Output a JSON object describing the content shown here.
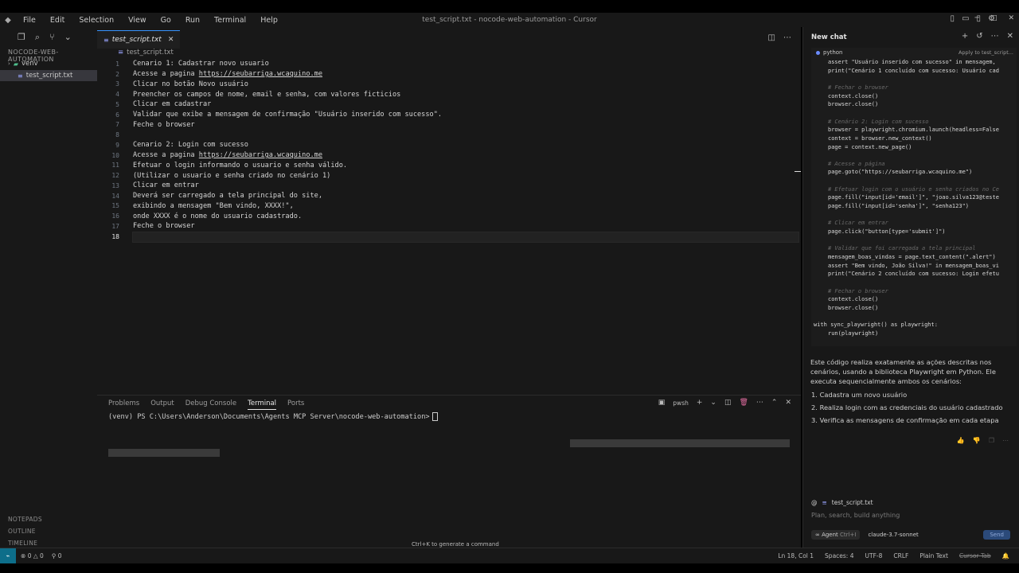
{
  "window": {
    "title": "test_script.txt - nocode-web-automation - Cursor",
    "menu": [
      "File",
      "Edit",
      "Selection",
      "View",
      "Go",
      "Run",
      "Terminal",
      "Help"
    ]
  },
  "sidebar": {
    "title": "NOCODE-WEB-AUTOMATION",
    "items": [
      {
        "label": "venv",
        "type": "folder"
      },
      {
        "label": "test_script.txt",
        "type": "file"
      }
    ],
    "footer": [
      "NOTEPADS",
      "OUTLINE",
      "TIMELINE"
    ]
  },
  "editor": {
    "tab": "test_script.txt",
    "breadcrumb": "test_script.txt",
    "lines": [
      {
        "n": "1",
        "text": "Cenario 1: Cadastrar novo usuario"
      },
      {
        "n": "2",
        "pre": "Acesse a pagina ",
        "link": "https://seubarriga.wcaquino.me"
      },
      {
        "n": "3",
        "text": "Clicar no botão Novo usuário"
      },
      {
        "n": "4",
        "text": "Preencher os campos de nome, email e senha, com valores ficticios"
      },
      {
        "n": "5",
        "text": "Clicar em cadastrar"
      },
      {
        "n": "6",
        "text": "Validar que exibe a mensagem de confirmação \"Usuário inserido com sucesso\"."
      },
      {
        "n": "7",
        "text": "Feche o browser"
      },
      {
        "n": "8",
        "text": ""
      },
      {
        "n": "9",
        "text": "Cenario 2: Login com sucesso"
      },
      {
        "n": "10",
        "pre": "Acesse a pagina ",
        "link": "https://seubarriga.wcaquino.me"
      },
      {
        "n": "11",
        "text": "Efetuar o login informando o usuario e senha válido."
      },
      {
        "n": "12",
        "text": "(Utilizar o usuario e senha criado no cenário 1)"
      },
      {
        "n": "13",
        "text": "Clicar em entrar"
      },
      {
        "n": "14",
        "text": "Deverá ser carregado a tela principal do site,"
      },
      {
        "n": "15",
        "text": "exibindo a mensagem \"Bem vindo, XXXX!\","
      },
      {
        "n": "16",
        "text": "onde XXXX é o nome do usuario cadastrado."
      },
      {
        "n": "17",
        "text": "Feche o browser"
      },
      {
        "n": "18",
        "text": ""
      }
    ]
  },
  "panel": {
    "tabs": [
      "Problems",
      "Output",
      "Debug Console",
      "Terminal",
      "Ports"
    ],
    "active_tab": "Terminal",
    "shell": "pwsh",
    "prompt": "(venv) PS C:\\Users\\Anderson\\Documents\\Agents MCP Server\\nocode-web-automation>",
    "hint": "Ctrl+K to generate a command"
  },
  "chat": {
    "title": "New chat",
    "code_lang": "python",
    "apply_label": "Apply to test_script...",
    "code_lines": [
      "assert \"Usuário inserido com sucesso\" in mensagem,",
      "print(\"Cenário 1 concluído com sucesso: Usuário cad",
      "",
      "# Fechar o browser",
      "context.close()",
      "browser.close()",
      "",
      "# Cenário 2: Login com sucesso",
      "browser = playwright.chromium.launch(headless=False",
      "context = browser.new_context()",
      "page = context.new_page()",
      "",
      "# Acesse a página",
      "page.goto(\"https://seubarriga.wcaquino.me\")",
      "",
      "# Efetuar login com o usuário e senha criados no Ce",
      "page.fill(\"input[id='email']\", \"joao.silva123@teste",
      "page.fill(\"input[id='senha']\", \"senha123\")",
      "",
      "# Clicar em entrar",
      "page.click(\"button[type='submit']\")",
      "",
      "# Validar que foi carregada a tela principal",
      "mensagem_boas_vindas = page.text_content(\".alert\")",
      "assert \"Bem vindo, João Silva!\" in mensagem_boas_vi",
      "print(\"Cenário 2 concluído com sucesso: Login efetu",
      "",
      "# Fechar o browser",
      "context.close()",
      "browser.close()",
      "",
      "with sync_playwright() as playwright:",
      "    run(playwright)"
    ],
    "explanation": "Este código realiza exatamente as ações descritas nos cenários, usando a biblioteca Playwright em Python. Ele executa sequencialmente ambos os cenários:",
    "list": [
      "Cadastra um novo usuário",
      "Realiza login com as credenciais do usuário cadastrado",
      "Verifica as mensagens de confirmação em cada etapa"
    ],
    "context_file": "test_script.txt",
    "input_placeholder": "Plan, search, build anything",
    "mode": "Agent",
    "mode_shortcut": "Ctrl+I",
    "model": "claude-3.7-sonnet",
    "send": "Send"
  },
  "status": {
    "errors": "0",
    "warnings": "0",
    "ports": "0",
    "position": "Ln 18, Col 1",
    "spaces": "Spaces: 4",
    "encoding": "UTF-8",
    "eol": "CRLF",
    "language": "Plain Text",
    "cursor_tab": "Cursor Tab"
  }
}
